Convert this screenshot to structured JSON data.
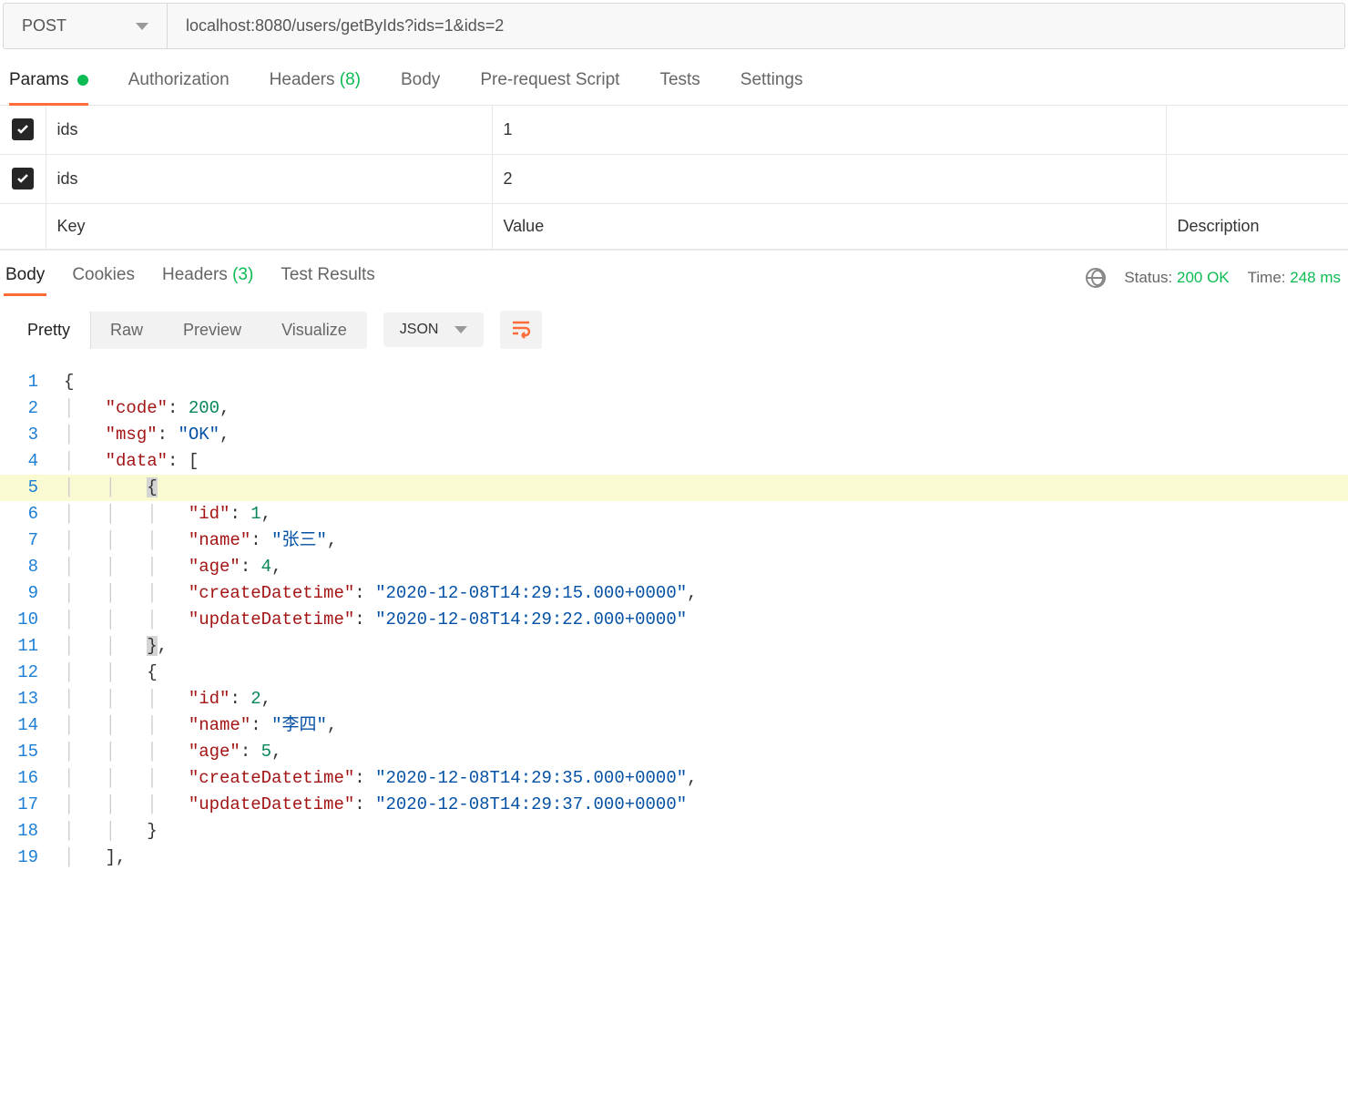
{
  "request": {
    "method": "POST",
    "url": "localhost:8080/users/getByIds?ids=1&ids=2"
  },
  "requestTabs": {
    "params": "Params",
    "authorization": "Authorization",
    "headers": "Headers",
    "headersCount": "(8)",
    "body": "Body",
    "prerequest": "Pre-request Script",
    "tests": "Tests",
    "settings": "Settings"
  },
  "params": {
    "rows": [
      {
        "key": "ids",
        "value": "1"
      },
      {
        "key": "ids",
        "value": "2"
      }
    ],
    "placeholders": {
      "key": "Key",
      "value": "Value",
      "description": "Description"
    }
  },
  "responseTabs": {
    "body": "Body",
    "cookies": "Cookies",
    "headers": "Headers",
    "headersCount": "(3)",
    "testResults": "Test Results"
  },
  "status": {
    "statusLabel": "Status:",
    "statusValue": "200 OK",
    "timeLabel": "Time:",
    "timeValue": "248 ms"
  },
  "viewBar": {
    "pretty": "Pretty",
    "raw": "Raw",
    "preview": "Preview",
    "visualize": "Visualize",
    "format": "JSON"
  },
  "responseBody": {
    "code": 200,
    "msg": "OK",
    "data": [
      {
        "id": 1,
        "name": "张三",
        "age": 4,
        "createDatetime": "2020-12-08T14:29:15.000+0000",
        "updateDatetime": "2020-12-08T14:29:22.000+0000"
      },
      {
        "id": 2,
        "name": "李四",
        "age": 5,
        "createDatetime": "2020-12-08T14:29:35.000+0000",
        "updateDatetime": "2020-12-08T14:29:37.000+0000"
      }
    ]
  },
  "code": {
    "l1": "{",
    "l2_k": "\"code\"",
    "l2_v": "200",
    "l3_k": "\"msg\"",
    "l3_v": "\"OK\"",
    "l4_k": "\"data\"",
    "l6_k": "\"id\"",
    "l6_v": "1",
    "l7_k": "\"name\"",
    "l7_v": "\"张三\"",
    "l8_k": "\"age\"",
    "l8_v": "4",
    "l9_k": "\"createDatetime\"",
    "l9_v": "\"2020-12-08T14:29:15.000+0000\"",
    "l10_k": "\"updateDatetime\"",
    "l10_v": "\"2020-12-08T14:29:22.000+0000\"",
    "l13_k": "\"id\"",
    "l13_v": "2",
    "l14_k": "\"name\"",
    "l14_v": "\"李四\"",
    "l15_k": "\"age\"",
    "l15_v": "5",
    "l16_k": "\"createDatetime\"",
    "l16_v": "\"2020-12-08T14:29:35.000+0000\"",
    "l17_k": "\"updateDatetime\"",
    "l17_v": "\"2020-12-08T14:29:37.000+0000\""
  }
}
